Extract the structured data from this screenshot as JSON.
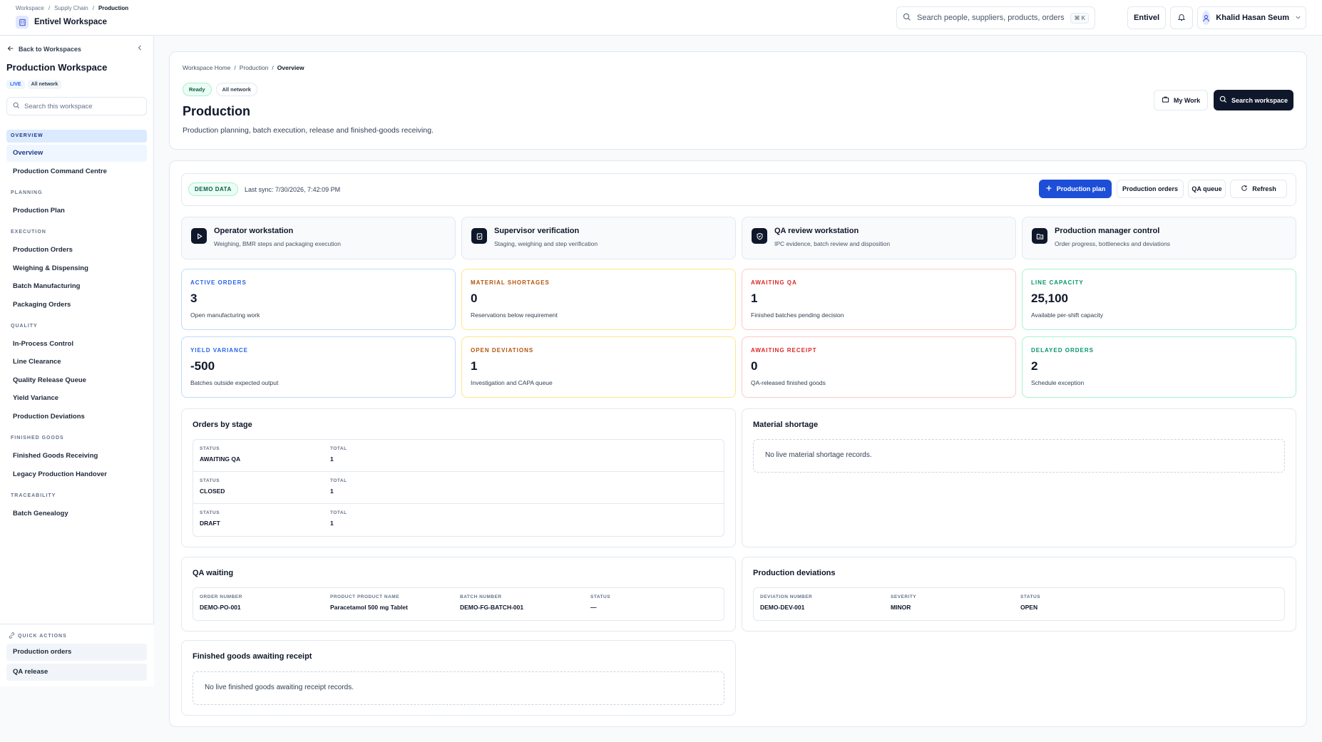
{
  "header": {
    "breadcrumb": [
      "Workspace",
      "Supply Chain",
      "Production"
    ],
    "workspace_name": "Entivel Workspace",
    "search_placeholder": "Search people, suppliers, products, orders and ...",
    "search_shortcut": "⌘ K",
    "org_button": "Entivel",
    "user_name": "Khalid Hasan Seum"
  },
  "sidebar": {
    "back_label": "Back to Workspaces",
    "title": "Production Workspace",
    "badges": [
      "LIVE",
      "All network"
    ],
    "search_placeholder": "Search this workspace",
    "sections": {
      "overview": "OVERVIEW",
      "planning": "PLANNING",
      "execution": "EXECUTION",
      "quality": "QUALITY",
      "finished_goods": "FINISHED GOODS",
      "traceability": "TRACEABILITY"
    },
    "items": {
      "overview": "Overview",
      "command_centre": "Production Command Centre",
      "production_plan": "Production Plan",
      "production_orders": "Production Orders",
      "weighing": "Weighing & Dispensing",
      "batch_manufacturing": "Batch Manufacturing",
      "packaging_orders": "Packaging Orders",
      "ipc": "In-Process Control",
      "line_clearance": "Line Clearance",
      "quality_release": "Quality Release Queue",
      "yield_variance": "Yield Variance",
      "deviations": "Production Deviations",
      "fg_receiving": "Finished Goods Receiving",
      "legacy_handover": "Legacy Production Handover",
      "batch_genealogy": "Batch Genealogy"
    },
    "quick_actions": {
      "title": "QUICK ACTIONS",
      "items": [
        "Production orders",
        "QA release"
      ]
    }
  },
  "page": {
    "breadcrumb": [
      "Workspace Home",
      "Production",
      "Overview"
    ],
    "badges": [
      "Ready",
      "All network"
    ],
    "title": "Production",
    "subtitle": "Production planning, batch execution, release and finished-goods receiving.",
    "my_work": "My Work",
    "search_workspace": "Search workspace"
  },
  "sync": {
    "demo_label": "DEMO DATA",
    "last_sync": "Last sync: 7/30/2026, 7:42:09 PM",
    "buttons": {
      "production_plan": "Production plan",
      "production_orders": "Production orders",
      "qa_queue": "QA queue",
      "refresh": "Refresh"
    }
  },
  "workstations": [
    {
      "title": "Operator workstation",
      "subtitle": "Weighing, BMR steps and packaging execution"
    },
    {
      "title": "Supervisor verification",
      "subtitle": "Staging, weighing and step verification"
    },
    {
      "title": "QA review workstation",
      "subtitle": "IPC evidence, batch review and disposition"
    },
    {
      "title": "Production manager control",
      "subtitle": "Order progress, bottlenecks and deviations"
    }
  ],
  "kpis": [
    {
      "label": "ACTIVE ORDERS",
      "value": "3",
      "sub": "Open manufacturing work",
      "color": "#2563eb",
      "border": "#bfdbfe"
    },
    {
      "label": "MATERIAL SHORTAGES",
      "value": "0",
      "sub": "Reservations below requirement",
      "color": "#b45309",
      "border": "#fde68a"
    },
    {
      "label": "AWAITING QA",
      "value": "1",
      "sub": "Finished batches pending decision",
      "color": "#dc2626",
      "border": "#fecaca"
    },
    {
      "label": "LINE CAPACITY",
      "value": "25,100",
      "sub": "Available per-shift capacity",
      "color": "#059669",
      "border": "#a7f3d0"
    },
    {
      "label": "YIELD VARIANCE",
      "value": "-500",
      "sub": "Batches outside expected output",
      "color": "#2563eb",
      "border": "#bfdbfe"
    },
    {
      "label": "OPEN DEVIATIONS",
      "value": "1",
      "sub": "Investigation and CAPA queue",
      "color": "#b45309",
      "border": "#fde68a"
    },
    {
      "label": "AWAITING RECEIPT",
      "value": "0",
      "sub": "QA-released finished goods",
      "color": "#dc2626",
      "border": "#fecaca"
    },
    {
      "label": "DELAYED ORDERS",
      "value": "2",
      "sub": "Schedule exception",
      "color": "#059669",
      "border": "#a7f3d0"
    }
  ],
  "orders_by_stage": {
    "title": "Orders by stage",
    "col_status": "STATUS",
    "col_total": "TOTAL",
    "rows": [
      {
        "status": "AWAITING QA",
        "total": "1"
      },
      {
        "status": "CLOSED",
        "total": "1"
      },
      {
        "status": "DRAFT",
        "total": "1"
      }
    ]
  },
  "material_shortage": {
    "title": "Material shortage",
    "empty": "No live material shortage records."
  },
  "qa_waiting": {
    "title": "QA waiting",
    "headers": [
      "ORDER NUMBER",
      "PRODUCT PRODUCT NAME",
      "BATCH NUMBER",
      "STATUS"
    ],
    "row": [
      "DEMO-PO-001",
      "Paracetamol 500 mg Tablet",
      "DEMO-FG-BATCH-001",
      "—"
    ]
  },
  "production_deviations": {
    "title": "Production deviations",
    "headers": [
      "DEVIATION NUMBER",
      "SEVERITY",
      "STATUS"
    ],
    "row": [
      "DEMO-DEV-001",
      "MINOR",
      "OPEN"
    ]
  },
  "fg_awaiting": {
    "title": "Finished goods awaiting receipt",
    "empty": "No live finished goods awaiting receipt records."
  }
}
